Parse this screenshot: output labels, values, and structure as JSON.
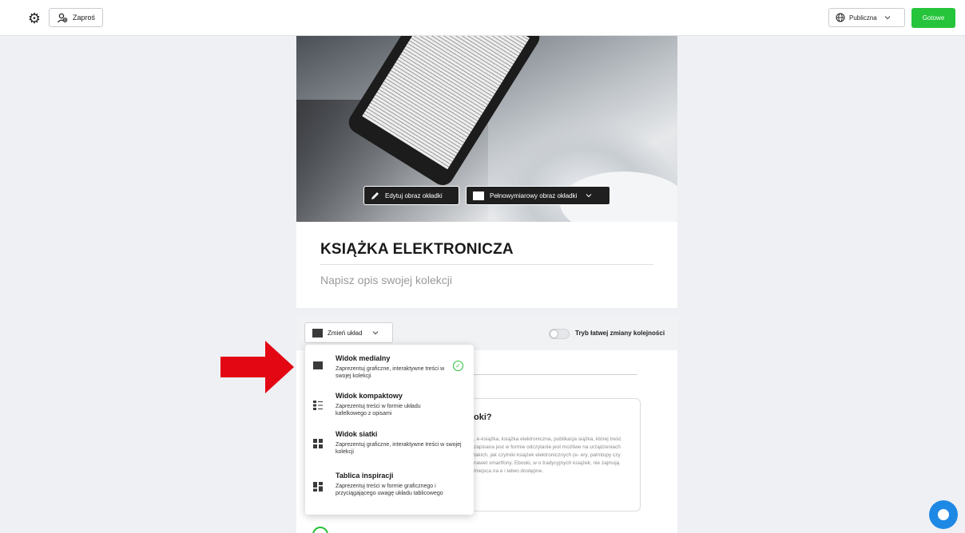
{
  "topbar": {
    "invite_label": "Zaproś",
    "visibility_label": "Publiczna",
    "done_label": "Gotowe"
  },
  "cover": {
    "edit_label": "Edytuj obraz okładki",
    "fullsize_label": "Pełnowymiarowy obraz okładki"
  },
  "collection": {
    "title": "KSIĄŻKA ELEKTRONICZA",
    "description_placeholder": "Napisz opis swojej kolekcji"
  },
  "toolbar": {
    "change_layout_label": "Zmień układ",
    "reorder_label": "Tryb łatwej zmiany kolejności"
  },
  "layout_menu": {
    "items": [
      {
        "title": "Widok medialny",
        "desc": "Zaprezentuj graficzne, interaktywne treści w swojej kolekcji",
        "icon": "media-view-icon",
        "selected": true
      },
      {
        "title": "Widok kompaktowy",
        "desc": "Zaprezentuj treści w formie układu kafelkowego z opisami",
        "icon": "compact-view-icon",
        "selected": false
      },
      {
        "title": "Widok siatki",
        "desc": "Zaprezentuj graficzne, interaktywne treści w swojej kolekcji",
        "icon": "grid-view-icon",
        "selected": false
      },
      {
        "title": "Tablica inspiracji",
        "desc": "Zaprezentuj treści w formie graficznego i przyciągającego uwagę układu tablicowego",
        "icon": "board-view-icon",
        "selected": false
      }
    ]
  },
  "article": {
    "heading_fragment": "oki?",
    "text_fragment": ", e-książka, książka elektroniczna, publikacja siążka, której treść zapisana jest w formie odczytanie jest możliwe na urządzeniach takich, jak czytniki książek elektronicznych (e- ery, palmtopy czy nawet smartfony. Ebooki, w o tradycyjnych książek, nie zajmują miejsca na e i łatwo dostępne."
  },
  "colors": {
    "accent_green": "#26c43b",
    "arrow_red": "#e30613",
    "chat_blue": "#1e88e5"
  }
}
